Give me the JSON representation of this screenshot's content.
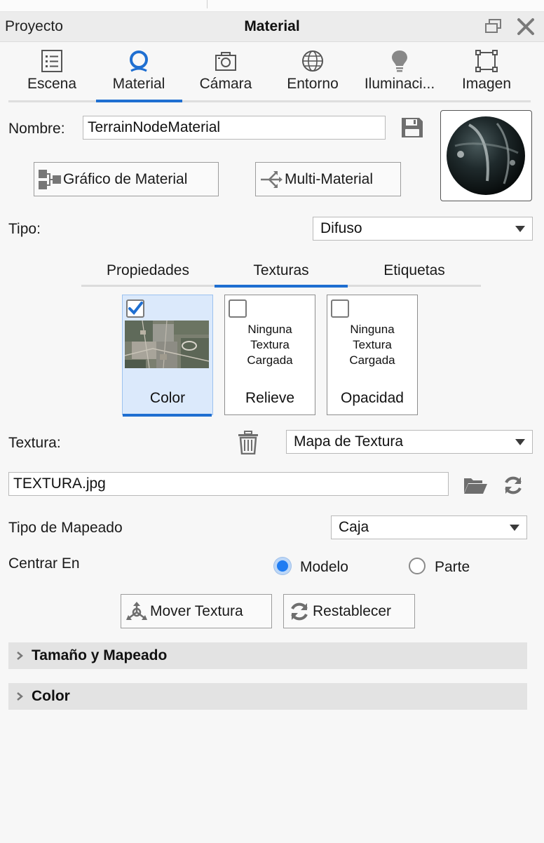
{
  "panel": {
    "left_title": "Proyecto",
    "title": "Material"
  },
  "tabs": [
    {
      "label": "Escena",
      "icon": "list-icon"
    },
    {
      "label": "Material",
      "icon": "material-icon"
    },
    {
      "label": "Cámara",
      "icon": "camera-icon"
    },
    {
      "label": "Entorno",
      "icon": "globe-icon"
    },
    {
      "label": "Iluminaci...",
      "icon": "lightbulb-icon"
    },
    {
      "label": "Imagen",
      "icon": "image-frame-icon"
    }
  ],
  "active_tab": "Material",
  "name": {
    "label": "Nombre:",
    "value": "TerrainNodeMaterial"
  },
  "buttons": {
    "graph": "Gráfico de Material",
    "multi": "Multi-Material",
    "move_texture": "Mover Textura",
    "reset": "Restablecer"
  },
  "type": {
    "label": "Tipo:",
    "value": "Difuso"
  },
  "subtabs": [
    "Propiedades",
    "Texturas",
    "Etiquetas"
  ],
  "active_subtab": "Texturas",
  "texture_slots": [
    {
      "label": "Color",
      "checked": true,
      "selected": true
    },
    {
      "label": "Relieve",
      "checked": false,
      "empty_line1": "Ninguna",
      "empty_line2": "Textura",
      "empty_line3": "Cargada"
    },
    {
      "label": "Opacidad",
      "checked": false,
      "empty_line1": "Ninguna",
      "empty_line2": "Textura",
      "empty_line3": "Cargada"
    }
  ],
  "texture": {
    "label": "Textura:",
    "map_type": "Mapa de Textura",
    "file": "TEXTURA.jpg"
  },
  "mapping": {
    "label": "Tipo de Mapeado",
    "value": "Caja"
  },
  "center": {
    "label": "Centrar En",
    "option_model": "Modelo",
    "option_part": "Parte",
    "selected": "Modelo"
  },
  "sections": [
    {
      "label": "Tamaño y Mapeado"
    },
    {
      "label": "Color"
    }
  ],
  "colors": {
    "accent": "#1f6fd1",
    "radio_selected": "#1f7cf2",
    "selected_card": "#dbe9fb"
  }
}
